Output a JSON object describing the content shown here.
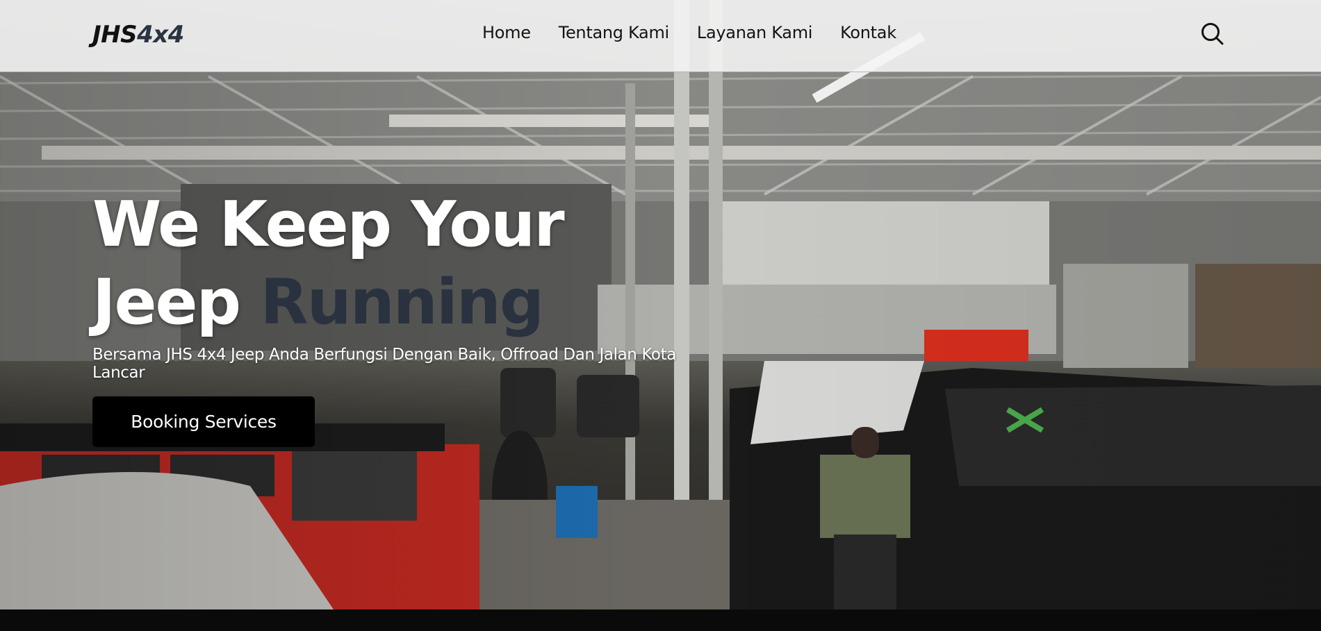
{
  "header": {
    "logo_main": "JHS",
    "logo_accent": "4x4",
    "nav": [
      "Home",
      "Tentang Kami",
      "Layanan Kami",
      "Kontak"
    ],
    "search_icon": "search-icon"
  },
  "hero": {
    "title_line1": "We Keep Your",
    "title_line2_light": "Jeep",
    "title_line2_dark": "Running",
    "subtitle": "Bersama JHS 4x4 Jeep Anda Berfungsi Dengan Baik, Offroad Dan Jalan Kota Lancar",
    "cta_label": "Booking Services"
  },
  "colors": {
    "nav_bg": "#f4f4f4",
    "title_accent": "#2a3240",
    "button_bg": "#000000",
    "button_text": "#ffffff"
  }
}
